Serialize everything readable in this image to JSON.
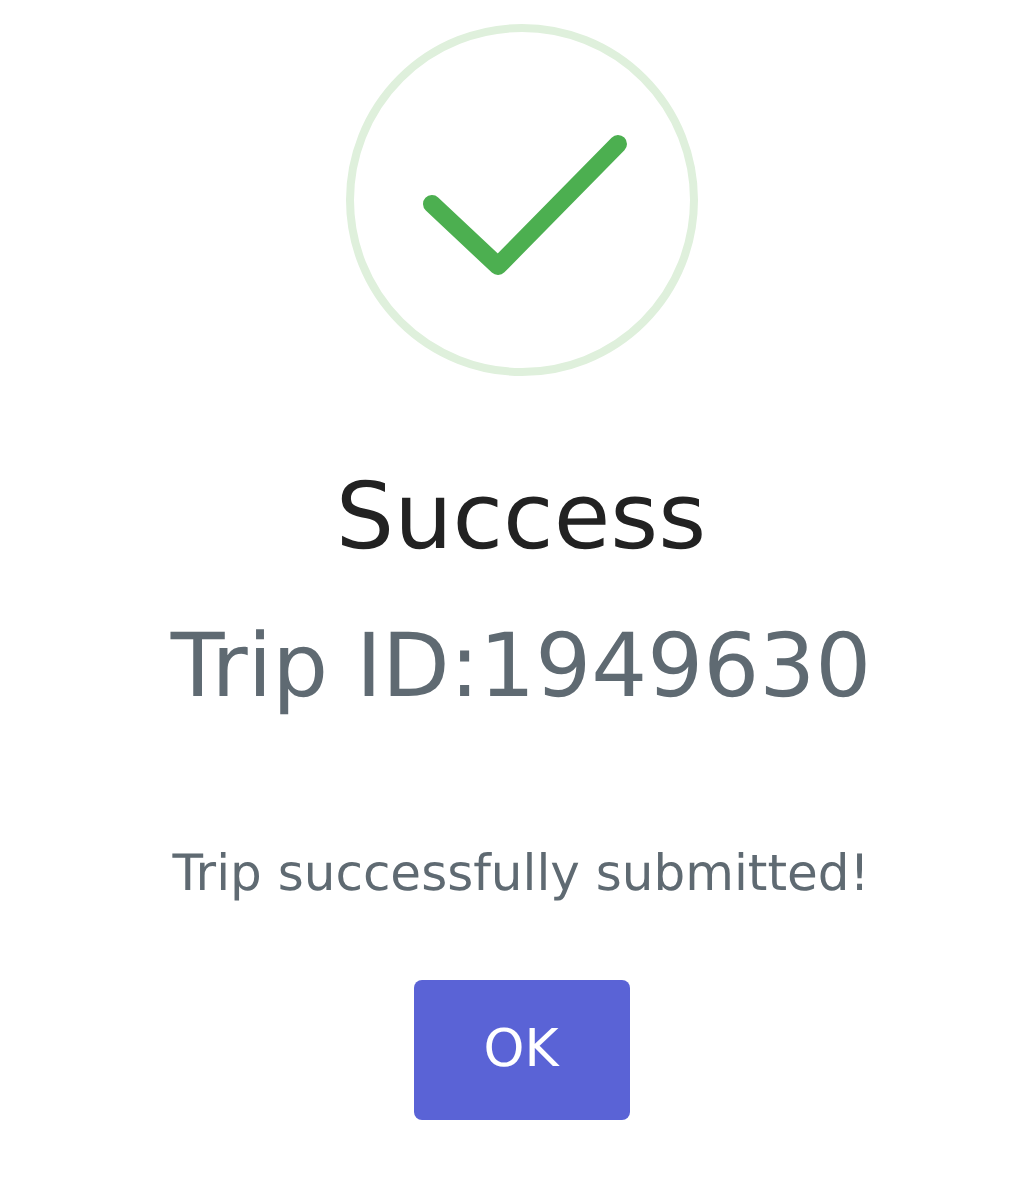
{
  "title": "Success",
  "trip_id": "Trip ID:1949630",
  "message": "Trip successfully submitted!",
  "buttons": [
    "OK"
  ]
}
